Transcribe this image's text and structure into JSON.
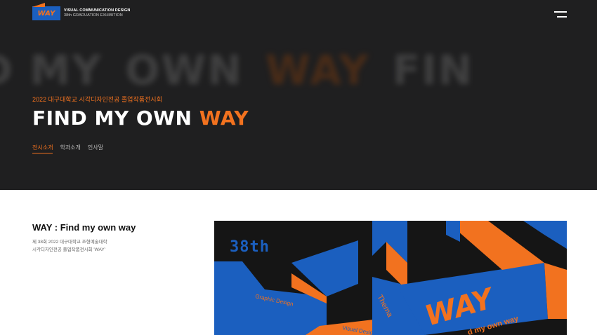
{
  "header": {
    "logo_mark": "WAY",
    "logo_line1": "VISUAL COMMUNICATION DESIGN",
    "logo_line2": "38th GRADUATION EXHIBITION",
    "menu_icon": "hamburger-menu-icon"
  },
  "hero": {
    "background_words": [
      "D MY",
      "OWN",
      "WAY",
      "FIN"
    ],
    "subtitle": "2022 대구대학교 시각디자인전공 졸업작품전시회",
    "title_main": "FIND MY OWN ",
    "title_accent": "WAY",
    "tabs": [
      {
        "label": "전시소개",
        "active": true
      },
      {
        "label": "학과소개",
        "active": false
      },
      {
        "label": "인사말",
        "active": false
      }
    ]
  },
  "intro": {
    "title": "WAY : Find my own way",
    "desc_line1": "제 38회 2022 대구대학교 조형예술대학",
    "desc_line2": "시각디자인전공 졸업작품전시회 'WAY'"
  },
  "poster": {
    "number": "38th",
    "label_graphic": "Graphic Design",
    "label_visual": "Visual Design",
    "label_thema": "Thema",
    "word": "WAY",
    "tagline": "d my own way"
  },
  "colors": {
    "accent_orange": "#f2721f",
    "brand_blue": "#1b5fbf",
    "hero_bg": "#1f1f20"
  }
}
